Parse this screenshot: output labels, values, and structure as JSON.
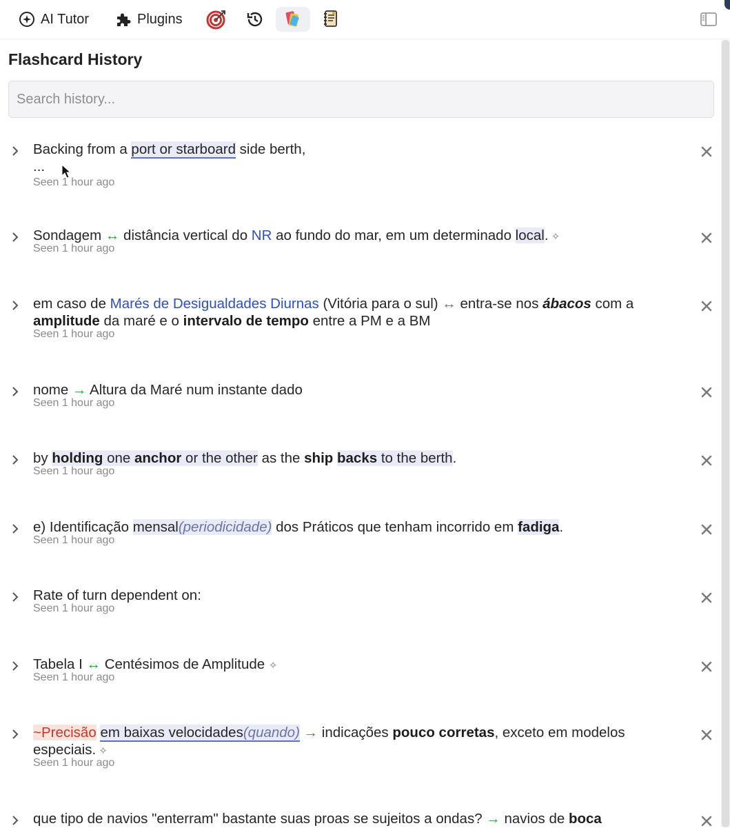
{
  "toolbar": {
    "tutor_label": "AI Tutor",
    "plugins_label": "Plugins"
  },
  "title": "Flashcard History",
  "search": {
    "placeholder": "Search history..."
  },
  "items": [
    {
      "parts": [
        {
          "t": "Backing from a "
        },
        {
          "t": "port or starboard",
          "c": "hl ul"
        },
        {
          "t": " side berth,"
        },
        {
          "t": "\n..."
        }
      ],
      "seen": "Seen 1 hour ago"
    },
    {
      "parts": [
        {
          "t": "Sondagem "
        },
        {
          "t": "↔",
          "c": "arrow"
        },
        {
          "t": " distância vertical do "
        },
        {
          "t": "NR",
          "c": "blue"
        },
        {
          "t": "  ao fundo do mar, em um determinado "
        },
        {
          "t": "local",
          "c": "hl"
        },
        {
          "t": "."
        },
        {
          "t": " ✧",
          "c": "pin"
        }
      ],
      "seen": "Seen 1 hour ago"
    },
    {
      "parts": [
        {
          "t": "em caso de "
        },
        {
          "t": "Marés de Desigualdades Diurnas",
          "c": "blue"
        },
        {
          "t": " (Vitória para o sul) "
        },
        {
          "t": "↔",
          "c": "arrow"
        },
        {
          "t": " entra-se nos "
        },
        {
          "t": "ábacos",
          "c": "bi"
        },
        {
          "t": " com a "
        },
        {
          "t": "amplitude",
          "c": "b"
        },
        {
          "t": " da maré e o "
        },
        {
          "t": "intervalo de tempo",
          "c": "b"
        },
        {
          "t": " entre a PM e a BM"
        }
      ],
      "seen": "Seen 1 hour ago"
    },
    {
      "parts": [
        {
          "t": "nome "
        },
        {
          "t": "→",
          "c": "arrow"
        },
        {
          "t": " Altura da Maré num instante dado"
        }
      ],
      "seen": "Seen 1 hour ago"
    },
    {
      "parts": [
        {
          "t": "by "
        },
        {
          "t": "holding",
          "c": "b hl"
        },
        {
          "t": " one ",
          "c": "hl"
        },
        {
          "t": "anchor",
          "c": "b hl"
        },
        {
          "t": " or the other",
          "c": "hl"
        },
        {
          "t": " as the "
        },
        {
          "t": "ship",
          "c": "b"
        },
        {
          "t": " "
        },
        {
          "t": "backs",
          "c": "b hl"
        },
        {
          "t": " to the berth",
          "c": "hl"
        },
        {
          "t": "."
        }
      ],
      "seen": "Seen 1 hour ago"
    },
    {
      "parts": [
        {
          "t": "e) Identificação "
        },
        {
          "t": "mensal",
          "c": "hl"
        },
        {
          "t": "(periodicidade)",
          "c": "hl ital-muted"
        },
        {
          "t": " dos Práticos que tenham incorrido em "
        },
        {
          "t": "fadiga",
          "c": "b hl"
        },
        {
          "t": "."
        }
      ],
      "seen": "Seen 1 hour ago"
    },
    {
      "parts": [
        {
          "t": "Rate of turn dependent on:"
        }
      ],
      "seen": "Seen 1 hour ago"
    },
    {
      "parts": [
        {
          "t": "Tabela I "
        },
        {
          "t": "↔",
          "c": "arrow"
        },
        {
          "t": " Centésimos de Amplitude "
        },
        {
          "t": " ✧",
          "c": "pin"
        }
      ],
      "seen": "Seen 1 hour ago"
    },
    {
      "parts": [
        {
          "t": "~Precisão",
          "c": "red-hl"
        },
        {
          "t": " "
        },
        {
          "t": "em baixas velocidades",
          "c": "hl ul"
        },
        {
          "t": "(quando)",
          "c": "hl ul ital-muted"
        },
        {
          "t": " "
        },
        {
          "t": "→",
          "c": "arrow"
        },
        {
          "t": " indicações "
        },
        {
          "t": "pouco corretas",
          "c": "b"
        },
        {
          "t": ", exceto em modelos especiais."
        },
        {
          "t": " ✧",
          "c": "pin"
        }
      ],
      "seen": "Seen 1 hour ago"
    },
    {
      "parts": [
        {
          "t": "que tipo de navios \"enterram\" bastante suas proas se sujeitos a ondas? "
        },
        {
          "t": "→",
          "c": "arrow"
        },
        {
          "t": " navios de "
        },
        {
          "t": "boca",
          "c": "b"
        }
      ],
      "seen": ""
    }
  ]
}
